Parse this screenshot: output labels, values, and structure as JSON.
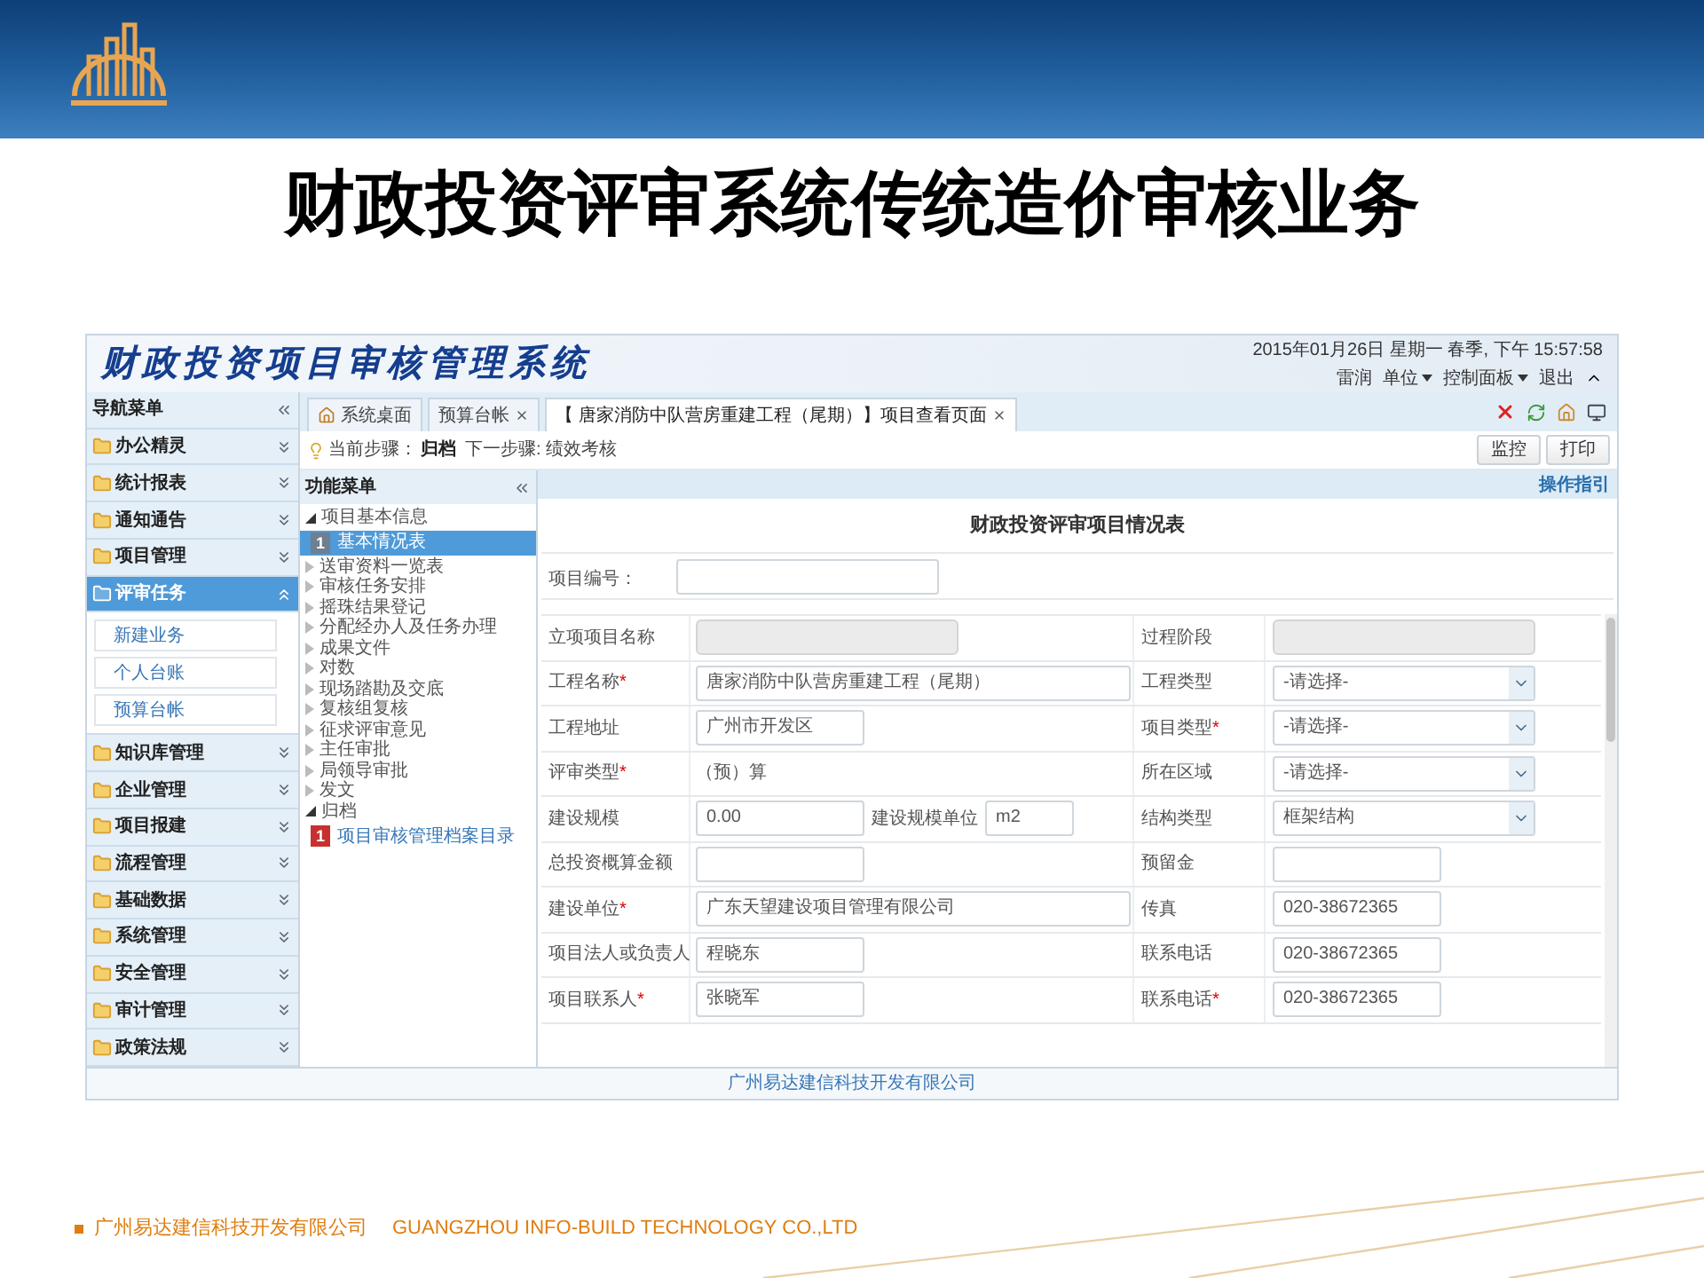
{
  "slide": {
    "title": "财政投资评审系统传统造价审核业务",
    "footer_company": "广州易达建信科技开发有限公司",
    "footer_english": "GUANGZHOU INFO-BUILD TECHNOLOGY CO.,LTD"
  },
  "app": {
    "title": "财政投资项目审核管理系统",
    "datetime": "2015年01月26日 星期一 春季, 下午 15:57:58",
    "user_links": [
      {
        "label": "雷润",
        "dropdown": false
      },
      {
        "label": "单位",
        "dropdown": true
      },
      {
        "label": "控制面板",
        "dropdown": true
      },
      {
        "label": "退出",
        "dropdown": false
      }
    ],
    "nav_header": "导航菜单",
    "nav_items": [
      {
        "label": "办公精灵",
        "expanded": false,
        "selected": false
      },
      {
        "label": "统计报表",
        "expanded": false,
        "selected": false
      },
      {
        "label": "通知通告",
        "expanded": false,
        "selected": false
      },
      {
        "label": "项目管理",
        "expanded": false,
        "selected": false
      },
      {
        "label": "评审任务",
        "expanded": true,
        "selected": true,
        "children": [
          "新建业务",
          "个人台账",
          "预算台帐"
        ]
      },
      {
        "label": "知识库管理",
        "expanded": false,
        "selected": false
      },
      {
        "label": "企业管理",
        "expanded": false,
        "selected": false
      },
      {
        "label": "项目报建",
        "expanded": false,
        "selected": false
      },
      {
        "label": "流程管理",
        "expanded": false,
        "selected": false
      },
      {
        "label": "基础数据",
        "expanded": false,
        "selected": false
      },
      {
        "label": "系统管理",
        "expanded": false,
        "selected": false
      },
      {
        "label": "安全管理",
        "expanded": false,
        "selected": false
      },
      {
        "label": "审计管理",
        "expanded": false,
        "selected": false
      },
      {
        "label": "政策法规",
        "expanded": false,
        "selected": false
      }
    ],
    "tabs": [
      {
        "label": "系统桌面",
        "selected": false,
        "closable": false
      },
      {
        "label": "预算台帐",
        "selected": false,
        "closable": true
      },
      {
        "label": "【 唐家消防中队营房重建工程（尾期）】项目查看页面",
        "selected": true,
        "closable": true
      }
    ],
    "step": {
      "label": "当前步骤：",
      "current": "归档",
      "next": "下一步骤: 绩效考核"
    },
    "actions": [
      "监控",
      "打印"
    ],
    "menu": {
      "title": "功能菜单",
      "tree": [
        {
          "label": "项目基本信息",
          "expanded": true,
          "children": [
            {
              "label": "基本情况表",
              "badge": "1",
              "selected": true
            }
          ]
        },
        {
          "label": "送审资料一览表",
          "expanded": false
        },
        {
          "label": "审核任务安排",
          "expanded": false
        },
        {
          "label": "摇珠结果登记",
          "expanded": false
        },
        {
          "label": "分配经办人及任务办理",
          "expanded": false
        },
        {
          "label": "成果文件",
          "expanded": false
        },
        {
          "label": "对数",
          "expanded": false
        },
        {
          "label": "现场踏勘及交底",
          "expanded": false
        },
        {
          "label": "复核组复核",
          "expanded": false
        },
        {
          "label": "征求评审意见",
          "expanded": false
        },
        {
          "label": "主任审批",
          "expanded": false
        },
        {
          "label": "局领导审批",
          "expanded": false
        },
        {
          "label": "发文",
          "expanded": false
        },
        {
          "label": "归档",
          "expanded": true,
          "children": [
            {
              "label": "项目审核管理档案目录",
              "badge": "1",
              "selected": false
            }
          ]
        }
      ]
    },
    "form": {
      "guide_link": "操作指引",
      "title": "财政投资评审项目情况表",
      "number": {
        "label": "项目编号：",
        "field": {
          "kind": "input"
        }
      },
      "rows": [
        {
          "left": {
            "label": "立项项目名称",
            "field": {
              "kind": "disabled"
            }
          },
          "right": {
            "label": "过程阶段",
            "field": {
              "kind": "disabled"
            }
          }
        },
        {
          "left": {
            "label": "工程名称",
            "mark": "*",
            "field": {
              "kind": "input",
              "value": "唐家消防中队营房重建工程（尾期）"
            }
          },
          "right": {
            "label": "工程类型",
            "field": {
              "kind": "select",
              "value": "-请选择-"
            }
          }
        },
        {
          "left": {
            "label": "工程地址",
            "field": {
              "kind": "input",
              "value": "广州市开发区"
            }
          },
          "right": {
            "label": "项目类型",
            "mark": "*",
            "field": {
              "kind": "select",
              "value": "-请选择-"
            }
          }
        },
        {
          "left": {
            "label": "评审类型",
            "mark": "*",
            "field": {
              "kind": "text",
              "value": "（预）算"
            }
          },
          "right": {
            "label": "所在区域",
            "field": {
              "kind": "select",
              "value": "-请选择-"
            }
          }
        },
        {
          "left": {
            "label": "建设规模",
            "field": {
              "kind": "input",
              "value": "0.00"
            },
            "extra": {
              "label": "建设规模单位",
              "field": {
                "kind": "input",
                "value": "m2"
              }
            }
          },
          "right": {
            "label": "结构类型",
            "field": {
              "kind": "select",
              "value": "框架结构"
            }
          }
        },
        {
          "left": {
            "label": "总投资概算金额",
            "field": {
              "kind": "input"
            }
          },
          "right": {
            "label": "预留金",
            "field": {
              "kind": "input"
            }
          }
        },
        {
          "left": {
            "label": "建设单位",
            "mark": "*",
            "field": {
              "kind": "input",
              "value": "广东天望建设项目管理有限公司"
            }
          },
          "right": {
            "label": "传真",
            "field": {
              "kind": "input",
              "value": "020-38672365"
            }
          }
        },
        {
          "left": {
            "label": "项目法人或负责人",
            "field": {
              "kind": "input",
              "value": "程晓东"
            }
          },
          "right": {
            "label": "联系电话",
            "field": {
              "kind": "input",
              "value": "020-38672365"
            }
          }
        },
        {
          "left": {
            "label": "项目联系人",
            "mark": "*",
            "field": {
              "kind": "input",
              "value": "张晓军"
            }
          },
          "right": {
            "label": "联系电话",
            "mark": "*",
            "field": {
              "kind": "input",
              "value": "020-38672365"
            }
          }
        }
      ]
    },
    "copyright": "广州易达建信科技开发有限公司"
  }
}
